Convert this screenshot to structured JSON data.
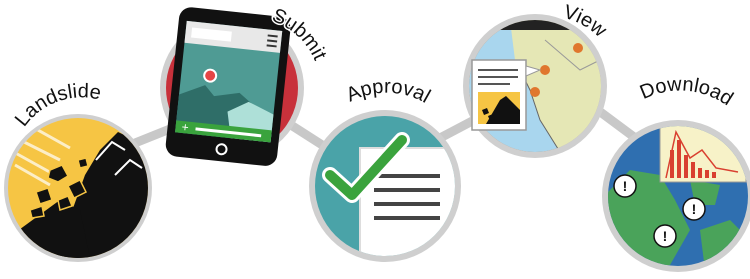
{
  "steps": [
    {
      "id": "landslide",
      "label": "Landslide",
      "icon": "landslide-icon"
    },
    {
      "id": "submit",
      "label": "Submit",
      "icon": "smartphone-icon"
    },
    {
      "id": "approval",
      "label": "Approval",
      "icon": "checkmark-document-icon"
    },
    {
      "id": "view",
      "label": "View",
      "icon": "map-icon"
    },
    {
      "id": "download",
      "label": "Download",
      "icon": "globe-chart-icon"
    }
  ],
  "colors": {
    "connector": "#c8c8c8",
    "ring": "#cfcfcf",
    "landslide_bg": "#f6c544",
    "submit_bg": "#c8313b",
    "approval_bg": "#4aa3a8",
    "view_bg": "#d97a3a",
    "download_bg": "#2f6fb0",
    "check_green": "#3aa33d",
    "land_green": "#4aa35a"
  }
}
